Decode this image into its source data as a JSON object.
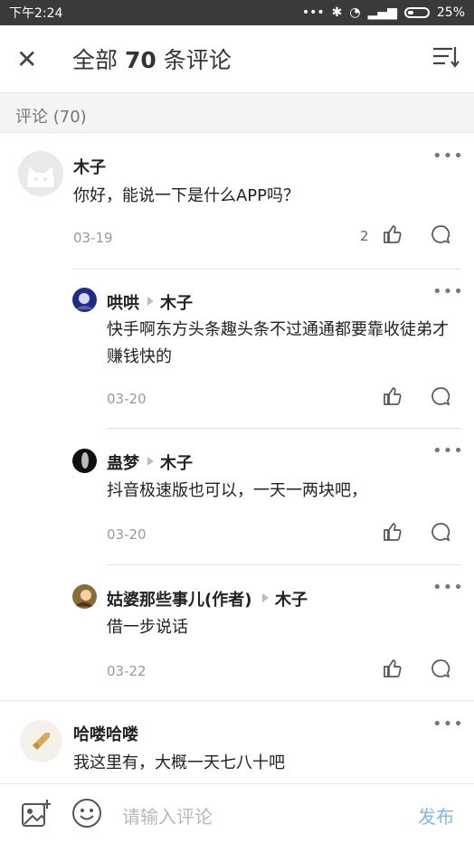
{
  "status": {
    "time": "下午2:24",
    "battery": "25%",
    "signal": "•••"
  },
  "header": {
    "title_prefix": "全部 ",
    "title_count": "70",
    "title_suffix": " 条评论"
  },
  "section": {
    "label": "评论 (70)"
  },
  "comments": [
    {
      "name": "木子",
      "text": "你好，能说一下是什么APP吗？",
      "date": "03-19",
      "likes": "2"
    },
    {
      "name": "哄哄",
      "reply_to": "木子",
      "text": "快手啊东方头条趣头条不过通通都要靠收徒弟才赚钱快的",
      "date": "03-20"
    },
    {
      "name": "蛊梦",
      "reply_to": "木子",
      "text": "抖音极速版也可以，一天一两块吧，",
      "date": "03-20"
    },
    {
      "name": "姑婆那些事儿(作者)",
      "reply_to": "木子",
      "text": "借一步说话",
      "date": "03-22"
    },
    {
      "name": "哈喽哈喽",
      "text": "我这里有，大概一天七八十吧"
    }
  ],
  "bottom": {
    "placeholder": "请输入评论",
    "publish": "发布"
  },
  "colors": {
    "accent": "#86b7e5",
    "statusbar": "#3a3a3a"
  },
  "icons": [
    "close-icon",
    "sort-icon",
    "more-icon",
    "like-icon",
    "comment-icon",
    "image-add-icon",
    "emoji-icon"
  ]
}
